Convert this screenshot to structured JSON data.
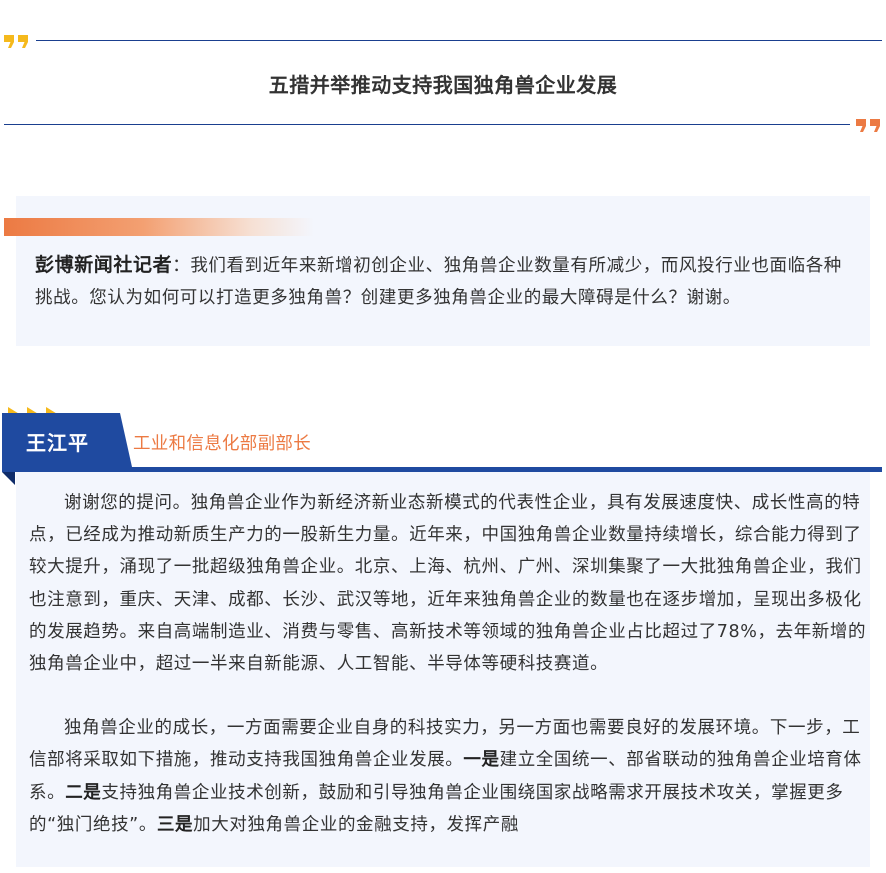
{
  "header": {
    "title": "五措并举推动支持我国独角兽企业发展",
    "quote_color_top": "#f5b91c",
    "quote_color_bottom": "#ec7a43",
    "rule_color": "#1a3f8f"
  },
  "question": {
    "speaker": "彭博新闻社记者",
    "separator": "：",
    "text": "我们看到近年来新增初创企业、独角兽企业数量有所减少，而风投行业也面临各种挑战。您认为如何可以打造更多独角兽？创建更多独角兽企业的最大障碍是什么？谢谢。",
    "accent_color": "#ec7a43"
  },
  "answer": {
    "speaker": "王江平",
    "role": "工业和信息化部副部长",
    "speaker_color": "#1f4aa0",
    "paragraph1": "谢谢您的提问。独角兽企业作为新经济新业态新模式的代表性企业，具有发展速度快、成长性高的特点，已经成为推动新质生产力的一股新生力量。近年来，中国独角兽企业数量持续增长，综合能力得到了较大提升，涌现了一批超级独角兽企业。北京、上海、杭州、广州、深圳集聚了一大批独角兽企业，我们也注意到，重庆、天津、成都、长沙、武汉等地，近年来独角兽企业的数量也在逐步增加，呈现出多极化的发展趋势。来自高端制造业、消费与零售、高新技术等领域的独角兽企业占比超过了78%，去年新增的独角兽企业中，超过一半来自新能源、人工智能、半导体等硬科技赛道。",
    "paragraph2": {
      "intro": "独角兽企业的成长，一方面需要企业自身的科技实力，另一方面也需要良好的发展环境。下一步，工信部将采取如下措施，推动支持我国独角兽企业发展。",
      "label1": "一是",
      "text1": "建立全国统一、部省联动的独角兽企业培育体系。",
      "label2": "二是",
      "text2": "支持独角兽企业技术创新，鼓励和引导独角兽企业围绕国家战略需求开展技术攻关，掌握更多的“独门绝技”。",
      "label3": "三是",
      "text3": "加大对独角兽企业的金融支持，发挥产融"
    }
  }
}
